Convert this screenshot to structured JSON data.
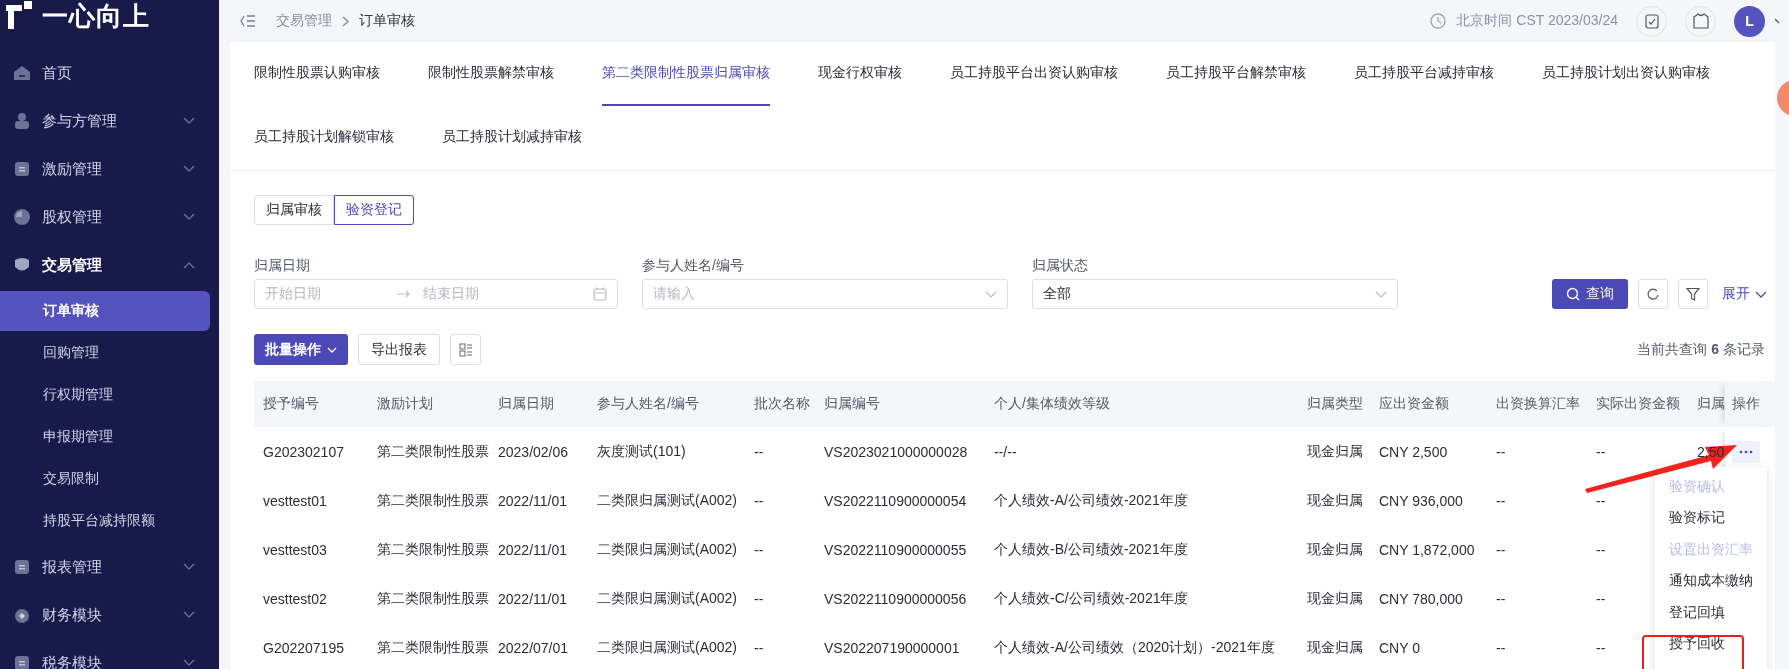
{
  "sidebar": {
    "logo": "一心向上",
    "items": [
      {
        "label": "首页",
        "kind": "link"
      },
      {
        "label": "参与方管理",
        "kind": "group",
        "expanded": false
      },
      {
        "label": "激励管理",
        "kind": "group",
        "expanded": false
      },
      {
        "label": "股权管理",
        "kind": "group",
        "expanded": false
      },
      {
        "label": "交易管理",
        "kind": "group",
        "expanded": true,
        "children": [
          {
            "label": "订单审核",
            "selected": true
          },
          {
            "label": "回购管理",
            "selected": false
          },
          {
            "label": "行权期管理",
            "selected": false
          },
          {
            "label": "申报期管理",
            "selected": false
          },
          {
            "label": "交易限制",
            "selected": false
          },
          {
            "label": "持股平台减持限额",
            "selected": false
          }
        ]
      },
      {
        "label": "报表管理",
        "kind": "group",
        "expanded": false
      },
      {
        "label": "财务模块",
        "kind": "group",
        "expanded": false
      },
      {
        "label": "税务模块",
        "kind": "group",
        "expanded": false
      }
    ]
  },
  "header": {
    "breadcrumb": [
      "交易管理",
      "订单审核"
    ],
    "time": "北京时间 CST 2023/03/24",
    "avatar": "L"
  },
  "tabs": [
    {
      "label": "限制性股票认购审核",
      "selected": false
    },
    {
      "label": "限制性股票解禁审核",
      "selected": false
    },
    {
      "label": "第二类限制性股票归属审核",
      "selected": true
    },
    {
      "label": "现金行权审核",
      "selected": false
    },
    {
      "label": "员工持股平台出资认购审核",
      "selected": false
    },
    {
      "label": "员工持股平台解禁审核",
      "selected": false
    },
    {
      "label": "员工持股平台减持审核",
      "selected": false
    },
    {
      "label": "员工持股计划出资认购审核",
      "selected": false
    },
    {
      "label": "员工持股计划解锁审核",
      "selected": false
    },
    {
      "label": "员工持股计划减持审核",
      "selected": false
    }
  ],
  "sub_tabs": [
    {
      "label": "归属审核",
      "selected": false
    },
    {
      "label": "验资登记",
      "selected": true
    }
  ],
  "filters": [
    {
      "kind": "daterange",
      "label": "归属日期",
      "start_placeholder": "开始日期",
      "end_placeholder": "结束日期"
    },
    {
      "kind": "select",
      "label": "参与人姓名/编号",
      "placeholder": "请输入"
    },
    {
      "kind": "select",
      "label": "归属状态",
      "value": "全部"
    }
  ],
  "query_button": "查询",
  "expand_link": "展开",
  "toolbar": {
    "batch_button": "批量操作",
    "export_button": "导出报表",
    "record_count": "当前共查询 **6** 条记录"
  },
  "table": {
    "columns": [
      "授予编号",
      "激励计划",
      "归属日期",
      "参与人姓名/编号",
      "批次名称",
      "归属编号",
      "个人/集体绩效等级",
      "归属类型",
      "应出资金额",
      "出资换算汇率",
      "实际出资金额",
      "归属",
      "操作"
    ],
    "rows": [
      [
        "G202302107",
        "第二类限制性股票",
        "2023/02/06",
        "灰度测试(101)",
        "--",
        "VS2023021000000028",
        "--/--",
        "现金归属",
        "CNY 2,500",
        "--",
        "--",
        "2,50"
      ],
      [
        "vesttest01",
        "第二类限制性股票",
        "2022/11/01",
        "二类限归属测试(A002)",
        "--",
        "VS2022110900000054",
        "个人绩效-A/公司绩效-2021年度",
        "现金归属",
        "CNY 936,000",
        "--",
        "--"
      ],
      [
        "vesttest03",
        "第二类限制性股票",
        "2022/11/01",
        "二类限归属测试(A002)",
        "--",
        "VS2022110900000055",
        "个人绩效-B/公司绩效-2021年度",
        "现金归属",
        "CNY 1,872,000",
        "--",
        "--"
      ],
      [
        "vesttest02",
        "第二类限制性股票",
        "2022/11/01",
        "二类限归属测试(A002)",
        "--",
        "VS2022110900000056",
        "个人绩效-C/公司绩效-2021年度",
        "现金归属",
        "CNY 780,000",
        "--",
        "--"
      ],
      [
        "G202207195",
        "第二类限制性股票",
        "2022/07/01",
        "二类限归属测试(A002)",
        "--",
        "VS202207190000001",
        "个人绩效-A/公司绩效（2020计划）-2021年度",
        "现金归属",
        "CNY 0",
        "--",
        "--"
      ]
    ]
  },
  "action_menu": {
    "items": [
      {
        "label": "验资确认",
        "disabled": true,
        "boxed": false
      },
      {
        "label": "验资标记",
        "disabled": false,
        "boxed": false
      },
      {
        "label": "设置出资汇率",
        "disabled": true,
        "boxed": false
      },
      {
        "label": "通知成本缴纳",
        "disabled": false,
        "boxed": false
      },
      {
        "label": "登记回填",
        "disabled": false,
        "boxed": false
      },
      {
        "label": "授予回收",
        "disabled": false,
        "boxed": true
      }
    ]
  },
  "annotation_arrow": true
}
